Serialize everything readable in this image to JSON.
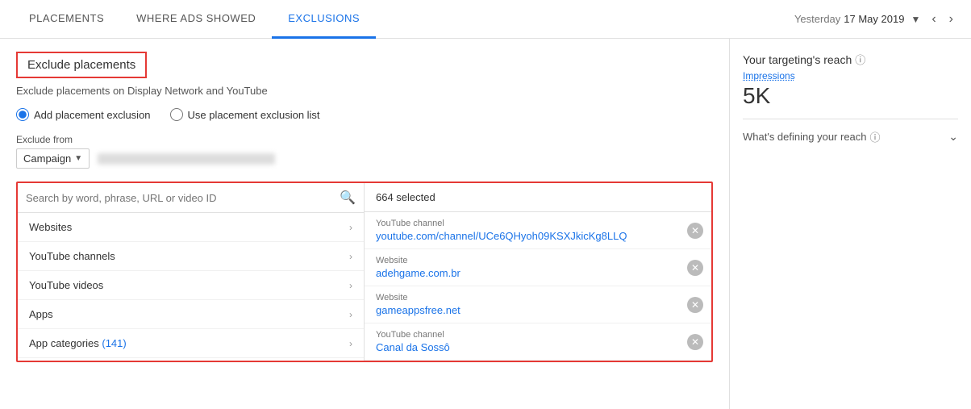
{
  "tabs": [
    {
      "id": "placements",
      "label": "PLACEMENTS",
      "active": false
    },
    {
      "id": "where-ads-showed",
      "label": "WHERE ADS SHOWED",
      "active": false
    },
    {
      "id": "exclusions",
      "label": "EXCLUSIONS",
      "active": true
    }
  ],
  "date": {
    "prefix": "Yesterday",
    "value": "17 May 2019"
  },
  "header": {
    "title": "Exclude placements",
    "subtitle": "Exclude placements on Display Network and YouTube"
  },
  "radio_options": [
    {
      "id": "add-exclusion",
      "label": "Add placement exclusion",
      "checked": true
    },
    {
      "id": "use-list",
      "label": "Use placement exclusion list",
      "checked": false
    }
  ],
  "exclude_from": {
    "label": "Exclude from",
    "dropdown_label": "Campaign"
  },
  "search": {
    "placeholder": "Search by word, phrase, URL or video ID"
  },
  "placement_categories": [
    {
      "id": "websites",
      "label": "Websites",
      "badge": null
    },
    {
      "id": "youtube-channels",
      "label": "YouTube channels",
      "badge": null
    },
    {
      "id": "youtube-videos",
      "label": "YouTube videos",
      "badge": null
    },
    {
      "id": "apps",
      "label": "Apps",
      "badge": null
    },
    {
      "id": "app-categories",
      "label": "App categories",
      "badge": "(141)"
    }
  ],
  "selected": {
    "count_label": "664 selected",
    "items": [
      {
        "type": "YouTube channel",
        "value": "youtube.com/channel/UCe6QHyoh09KSXJkicKg8LLQ"
      },
      {
        "type": "Website",
        "value": "adehgame.com.br"
      },
      {
        "type": "Website",
        "value": "gameappsfree.net"
      },
      {
        "type": "YouTube channel",
        "value": "Canal da Sossô"
      }
    ]
  },
  "sidebar": {
    "title": "Your targeting's reach",
    "impressions_label": "Impressions",
    "impressions_value": "5K",
    "defining_reach_label": "What's defining your reach"
  }
}
